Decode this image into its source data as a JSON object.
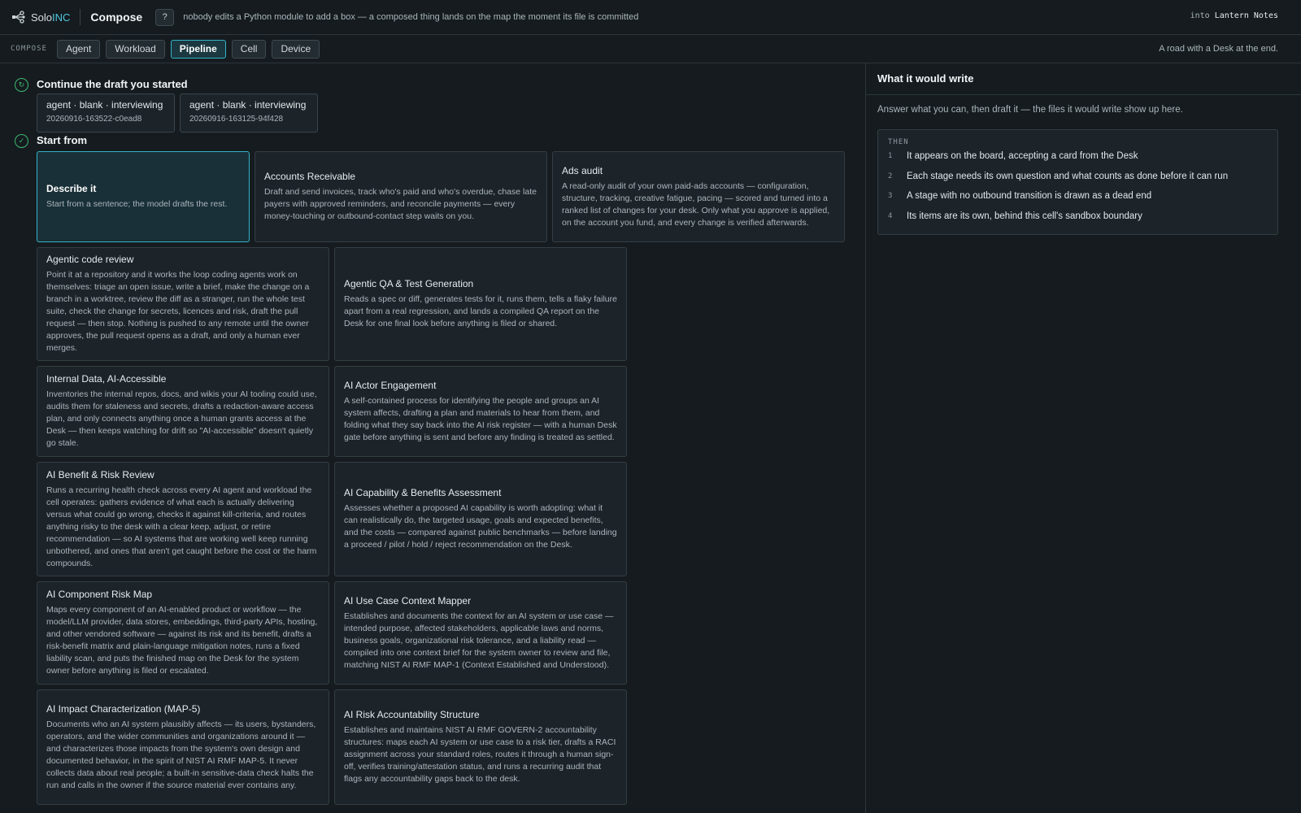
{
  "topbar": {
    "logo_pre": "Solo",
    "logo_accent": "INC",
    "app_title": "Compose",
    "help_label": "?",
    "tagline": "nobody edits a Python module to add a box — a composed thing lands on the map the moment its file is committed",
    "into_prefix": "into",
    "into_dest": "Lantern Notes"
  },
  "tabbar": {
    "label": "COMPOSE",
    "tabs": [
      {
        "label": "Agent"
      },
      {
        "label": "Workload"
      },
      {
        "label": "Pipeline",
        "active": true
      },
      {
        "label": "Cell"
      },
      {
        "label": "Device"
      }
    ],
    "description": "A road with a Desk at the end."
  },
  "main": {
    "continue": {
      "icon": "refresh-icon",
      "title": "Continue the draft you started",
      "drafts": [
        {
          "title": "agent · blank · interviewing",
          "id": "20260916-163522-c0ead8"
        },
        {
          "title": "agent · blank · interviewing",
          "id": "20260916-163125-94f428"
        }
      ]
    },
    "start": {
      "icon": "check-icon",
      "title": "Start from",
      "cards": [
        {
          "title": "Describe it",
          "desc": "Start from a sentence; the model drafts the rest.",
          "selected": true
        },
        {
          "title": "Accounts Receivable",
          "desc": "Draft and send invoices, track who's paid and who's overdue, chase late payers with approved reminders, and reconcile payments — every money-touching or outbound-contact step waits on you."
        },
        {
          "title": "Ads audit",
          "desc": "A read-only audit of your own paid-ads accounts — configuration, structure, tracking, creative fatigue, pacing — scored and turned into a ranked list of changes for your desk. Only what you approve is applied, on the account you fund, and every change is verified afterwards."
        },
        {
          "title": "Agentic code review",
          "desc": "Point it at a repository and it works the loop coding agents work on themselves: triage an open issue, write a brief, make the change on a branch in a worktree, review the diff as a stranger, run the whole test suite, check the change for secrets, licences and risk, draft the pull request — then stop. Nothing is pushed to any remote until the owner approves, the pull request opens as a draft, and only a human ever merges."
        },
        {
          "title": "Agentic QA & Test Generation",
          "desc": "Reads a spec or diff, generates tests for it, runs them, tells a flaky failure apart from a real regression, and lands a compiled QA report on the Desk for one final look before anything is filed or shared."
        },
        {
          "title": "Internal Data, AI-Accessible",
          "desc": "Inventories the internal repos, docs, and wikis your AI tooling could use, audits them for staleness and secrets, drafts a redaction-aware access plan, and only connects anything once a human grants access at the Desk — then keeps watching for drift so \"AI-accessible\" doesn't quietly go stale."
        },
        {
          "title": "AI Actor Engagement",
          "desc": "A self-contained process for identifying the people and groups an AI system affects, drafting a plan and materials to hear from them, and folding what they say back into the AI risk register — with a human Desk gate before anything is sent and before any finding is treated as settled."
        },
        {
          "title": "AI Benefit & Risk Review",
          "desc": "Runs a recurring health check across every AI agent and workload the cell operates: gathers evidence of what each is actually delivering versus what could go wrong, checks it against kill-criteria, and routes anything risky to the desk with a clear keep, adjust, or retire recommendation — so AI systems that are working well keep running unbothered, and ones that aren't get caught before the cost or the harm compounds."
        },
        {
          "title": "AI Capability & Benefits Assessment",
          "desc": "Assesses whether a proposed AI capability is worth adopting: what it can realistically do, the targeted usage, goals and expected benefits, and the costs — compared against public benchmarks — before landing a proceed / pilot / hold / reject recommendation on the Desk."
        },
        {
          "title": "AI Component Risk Map",
          "desc": "Maps every component of an AI-enabled product or workflow — the model/LLM provider, data stores, embeddings, third-party APIs, hosting, and other vendored software — against its risk and its benefit, drafts a risk-benefit matrix and plain-language mitigation notes, runs a fixed liability scan, and puts the finished map on the Desk for the system owner before anything is filed or escalated."
        },
        {
          "title": "AI Use Case Context Mapper",
          "desc": "Establishes and documents the context for an AI system or use case — intended purpose, affected stakeholders, applicable laws and norms, business goals, organizational risk tolerance, and a liability read — compiled into one context brief for the system owner to review and file, matching NIST AI RMF MAP-1 (Context Established and Understood)."
        },
        {
          "title": "AI Impact Characterization (MAP-5)",
          "desc": "Documents who an AI system plausibly affects — its users, bystanders, operators, and the wider communities and organizations around it — and characterizes those impacts from the system's own design and documented behavior, in the spirit of NIST AI RMF MAP-5. It never collects data about real people; a built-in sensitive-data check halts the run and calls in the owner if the source material ever contains any."
        },
        {
          "title": "AI Risk Accountability Structure",
          "desc": "Establishes and maintains NIST AI RMF GOVERN-2 accountability structures: maps each AI system or use case to a risk tier, drafts a RACI assignment across your standard roles, routes it through a human sign-off, verifies training/attestation status, and runs a recurring audit that flags any accountability gaps back to the desk."
        }
      ]
    }
  },
  "panel": {
    "title": "What it would write",
    "hint": "Answer what you can, then draft it — the files it would write show up here.",
    "then_label": "THEN",
    "items": [
      {
        "num": "1",
        "text": "It appears on the board, accepting a card from the Desk"
      },
      {
        "num": "2",
        "text": "Each stage needs its own question and what counts as done before it can run"
      },
      {
        "num": "3",
        "text": "A stage with no outbound transition is drawn as a dead end"
      },
      {
        "num": "4",
        "text": "Its items are its own, behind this cell's sandbox boundary"
      }
    ]
  }
}
